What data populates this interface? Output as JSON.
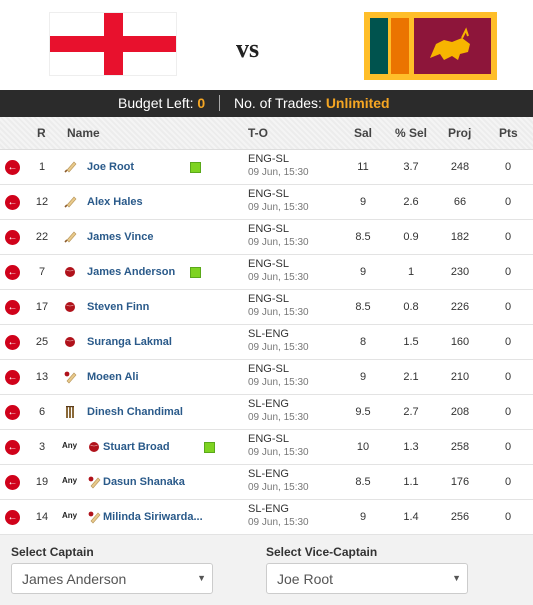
{
  "match": {
    "vs_label": "vs"
  },
  "budget": {
    "left_label": "Budget Left:",
    "left_value": "0",
    "trades_label": "No. of Trades:",
    "trades_value": "Unlimited"
  },
  "headers": {
    "r": "R",
    "name": "Name",
    "to": "T-O",
    "sal": "Sal",
    "pct": "% Sel",
    "proj": "Proj",
    "pts": "Pts"
  },
  "players": [
    {
      "r": "1",
      "name": "Joe Root",
      "to": "ENG-SL",
      "date": "09 Jun, 15:30",
      "sal": "11",
      "pct": "3.7",
      "proj": "248",
      "pts": "0"
    },
    {
      "r": "12",
      "name": "Alex Hales",
      "to": "ENG-SL",
      "date": "09 Jun, 15:30",
      "sal": "9",
      "pct": "2.6",
      "proj": "66",
      "pts": "0"
    },
    {
      "r": "22",
      "name": "James Vince",
      "to": "ENG-SL",
      "date": "09 Jun, 15:30",
      "sal": "8.5",
      "pct": "0.9",
      "proj": "182",
      "pts": "0"
    },
    {
      "r": "7",
      "name": "James Anderson",
      "to": "ENG-SL",
      "date": "09 Jun, 15:30",
      "sal": "9",
      "pct": "1",
      "proj": "230",
      "pts": "0"
    },
    {
      "r": "17",
      "name": "Steven Finn",
      "to": "ENG-SL",
      "date": "09 Jun, 15:30",
      "sal": "8.5",
      "pct": "0.8",
      "proj": "226",
      "pts": "0"
    },
    {
      "r": "25",
      "name": "Suranga Lakmal",
      "to": "SL-ENG",
      "date": "09 Jun, 15:30",
      "sal": "8",
      "pct": "1.5",
      "proj": "160",
      "pts": "0"
    },
    {
      "r": "13",
      "name": "Moeen Ali",
      "to": "ENG-SL",
      "date": "09 Jun, 15:30",
      "sal": "9",
      "pct": "2.1",
      "proj": "210",
      "pts": "0"
    },
    {
      "r": "6",
      "name": "Dinesh Chandimal",
      "to": "SL-ENG",
      "date": "09 Jun, 15:30",
      "sal": "9.5",
      "pct": "2.7",
      "proj": "208",
      "pts": "0"
    },
    {
      "r": "3",
      "any": "Any",
      "name": "Stuart Broad",
      "to": "ENG-SL",
      "date": "09 Jun, 15:30",
      "sal": "10",
      "pct": "1.3",
      "proj": "258",
      "pts": "0"
    },
    {
      "r": "19",
      "any": "Any",
      "name": "Dasun Shanaka",
      "to": "SL-ENG",
      "date": "09 Jun, 15:30",
      "sal": "8.5",
      "pct": "1.1",
      "proj": "176",
      "pts": "0"
    },
    {
      "r": "14",
      "any": "Any",
      "name": "Milinda Siriwarda...",
      "to": "SL-ENG",
      "date": "09 Jun, 15:30",
      "sal": "9",
      "pct": "1.4",
      "proj": "256",
      "pts": "0"
    }
  ],
  "captain": {
    "label": "Select Captain",
    "value": "James Anderson"
  },
  "vice_captain": {
    "label": "Select Vice-Captain",
    "value": "Joe Root"
  },
  "colors": {
    "accent": "#f5a623",
    "remove": "#d0021b",
    "selected": "#7ed321",
    "link": "#2a5a8a"
  }
}
